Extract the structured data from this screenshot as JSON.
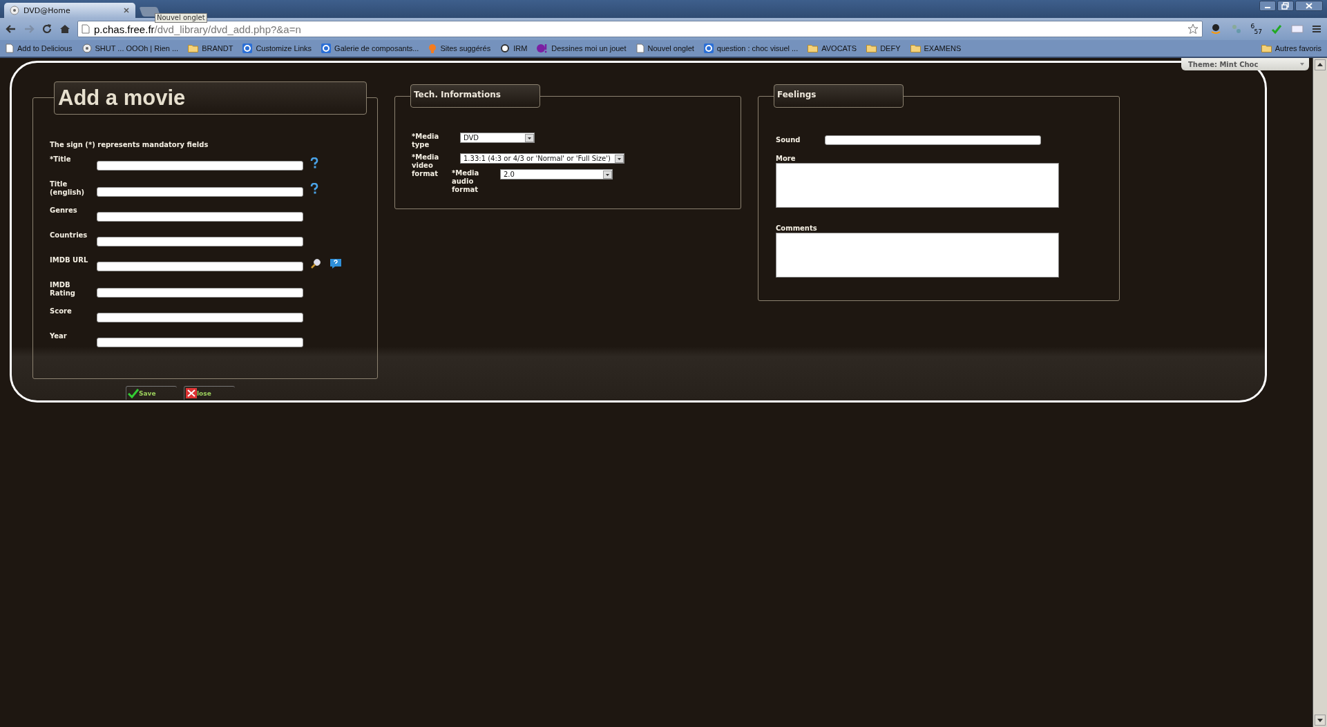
{
  "browser": {
    "tabs": [
      {
        "kind": "page",
        "title": "DVD@Home",
        "selected": true
      },
      {
        "kind": "new",
        "selected": false
      }
    ],
    "new_tab_tooltip": "Nouvel onglet",
    "address": {
      "host": "p.chas.free.fr",
      "path": "/dvd_library/dvd_add.php?&a=n"
    },
    "clock_badge": {
      "hours": "6",
      "minutes": "57"
    },
    "bookmarks": [
      {
        "label": "Add to Delicious",
        "kind": "page"
      },
      {
        "label": "SHUT ... OOOh | Rien ...",
        "kind": "disc"
      },
      {
        "label": "BRANDT",
        "kind": "folder"
      },
      {
        "label": "Customize Links",
        "kind": "web"
      },
      {
        "label": "Galerie de composants...",
        "kind": "web"
      },
      {
        "label": "Sites suggérés",
        "kind": "bulb"
      },
      {
        "label": "IRM",
        "kind": "ring"
      },
      {
        "label": "Dessines moi un jouet",
        "kind": "yahoo"
      },
      {
        "label": "Nouvel onglet",
        "kind": "page"
      },
      {
        "label": "question : choc visuel ...",
        "kind": "web"
      },
      {
        "label": "AVOCATS",
        "kind": "folder"
      },
      {
        "label": "DEFY",
        "kind": "folder"
      },
      {
        "label": "EXAMENS",
        "kind": "folder"
      }
    ],
    "other_bookmarks": "Autres favoris"
  },
  "theme_selector": {
    "value": "Theme: Mint Choc"
  },
  "movie_panel": {
    "title": "Add a movie",
    "note": "The sign (*) represents mandatory fields",
    "fields": [
      {
        "label": "*Title",
        "help": true,
        "lookup": false
      },
      {
        "label": "Title (english)",
        "help": true,
        "lookup": false
      },
      {
        "label": "Genres",
        "help": false,
        "lookup": false
      },
      {
        "label": "Countries",
        "help": false,
        "lookup": false
      },
      {
        "label": "IMDB URL",
        "help": false,
        "lookup": true
      },
      {
        "label": "IMDB Rating",
        "help": false,
        "lookup": false
      },
      {
        "label": "Score",
        "help": false,
        "lookup": false
      },
      {
        "label": "Year",
        "help": false,
        "lookup": false
      }
    ]
  },
  "tech_panel": {
    "title": "Tech. Informations",
    "fields": [
      {
        "label": "*Media type",
        "value": "DVD"
      },
      {
        "label": "*Media video format",
        "value": "1.33:1 (4:3 or 4/3 or 'Normal' or 'Full Size')",
        "children": [
          {
            "label": "*Media audio format",
            "value": "2.0"
          }
        ]
      }
    ]
  },
  "feelings_panel": {
    "title": "Feelings",
    "fields": [
      {
        "label": "Sound",
        "kind": "line"
      },
      {
        "label": "More",
        "kind": "area"
      },
      {
        "label": "Comments",
        "kind": "area"
      }
    ]
  },
  "buttons": [
    {
      "label": "Save",
      "kind": "save"
    },
    {
      "label": "lose",
      "kind": "close"
    }
  ]
}
